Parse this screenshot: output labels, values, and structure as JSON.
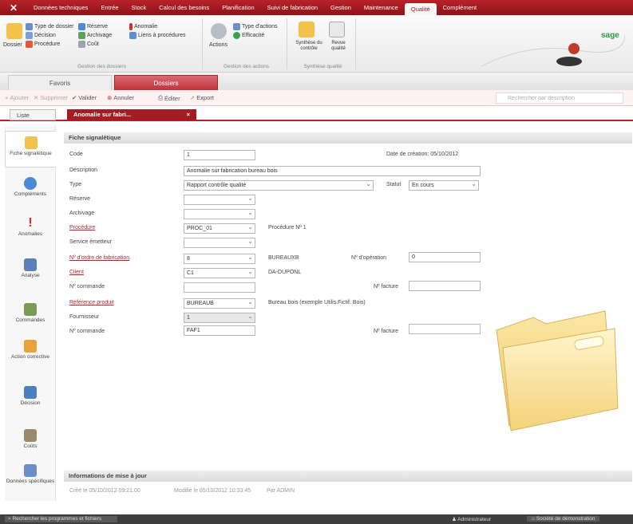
{
  "ribbon_tabs": [
    {
      "label": "Données techniques"
    },
    {
      "label": "Entrée"
    },
    {
      "label": "Stock"
    },
    {
      "label": "Calcul des besoins"
    },
    {
      "label": "Planification"
    },
    {
      "label": "Suivi de fabrication"
    },
    {
      "label": "Gestion"
    },
    {
      "label": "Maintenance"
    },
    {
      "label": "Qualité"
    },
    {
      "label": "Complément"
    }
  ],
  "ribbon": {
    "group1": {
      "big_label": "Dossier",
      "items": [
        "Type de dossier",
        "Décision",
        "Procédure",
        "Réserve",
        "Archivage",
        "Coût",
        "Anomalie",
        "Liens à procédures"
      ],
      "caption": "Gestion des dossiers"
    },
    "group2": {
      "big_label": "Actions",
      "items": [
        "Type d'actions",
        "Efficacité"
      ],
      "caption": "Gestion des actions"
    },
    "group3": {
      "items": [
        "Synthèse du contrôle",
        "Revue qualité"
      ],
      "caption": "Synthèse qualité"
    }
  },
  "sub_tabs": [
    "Favoris",
    "Dossiers"
  ],
  "toolbar": {
    "add": "Ajouter",
    "delete": "Supprimer",
    "validate": "Valider",
    "cancel": "Annuler",
    "edit": "Éditer",
    "export": "Export",
    "search_placeholder": "Rechercher par description"
  },
  "doc_tabs": [
    "Liste",
    "Anomalie sur fabri..."
  ],
  "left_nav": [
    {
      "label": "Fiche signalétique"
    },
    {
      "label": "Compléments"
    },
    {
      "label": "Anomalies"
    },
    {
      "label": "Analyse"
    },
    {
      "label": "Commandes"
    },
    {
      "label": "Action corrective"
    },
    {
      "label": "Décision"
    },
    {
      "label": "Coûts"
    },
    {
      "label": "Données spécifiques"
    }
  ],
  "form": {
    "section_title": "Fiche signalétique",
    "code_label": "Code",
    "code_value": "1",
    "date_creation": "Date de création: 05/10/2012",
    "description_label": "Description",
    "description_value": "Anomalie sur fabrication bureau bois",
    "type_label": "Type",
    "type_value": "Rapport contrôle qualité",
    "statut_label": "Statut",
    "statut_value": "En cours",
    "reserve_label": "Réserve",
    "reserve_value": "",
    "archivage_label": "Archivage",
    "archivage_value": "",
    "procedure_label": "Procédure",
    "procedure_value": "PROC_01",
    "procedure_text": "Procédure Nº 1",
    "service_label": "Service émetteur",
    "service_value": "",
    "of_label": "Nº d'ordre de fabrication",
    "of_value": "8",
    "of_text": "BUREAUXB",
    "operation_label": "Nº d'opération",
    "operation_value": "0",
    "client_label": "Client",
    "client_value": "C1",
    "client_text": "DA-DUPONL",
    "commande1_label": "Nº commande",
    "commande1_value": "",
    "facture1_label": "Nº facture",
    "facture1_value": "",
    "ref_label": "Référence produit",
    "ref_value": "BUREAUB",
    "ref_text": "Bureau bois (exemple Utilis.Fictif. Bois)",
    "fournisseur_label": "Fournisseur",
    "fournisseur_value": "1",
    "commande2_label": "Nº commande",
    "commande2_value": "FAF1",
    "facture2_label": "Nº facture",
    "facture2_value": ""
  },
  "info_section": {
    "title": "Informations de mise à jour",
    "created": "Créé le 05/10/2012 09:21:00",
    "modified": "Modifié le 05/10/2012 10:33:45",
    "by": "Par ADMIN"
  },
  "statusbar": {
    "search_programs": "Rechercher les programmes et fichiers",
    "admin": "Administrateur",
    "company": "Société de démonstration"
  },
  "colors": {
    "brand": "#a41d25",
    "ribbon_bg": "#f1f1f1"
  }
}
